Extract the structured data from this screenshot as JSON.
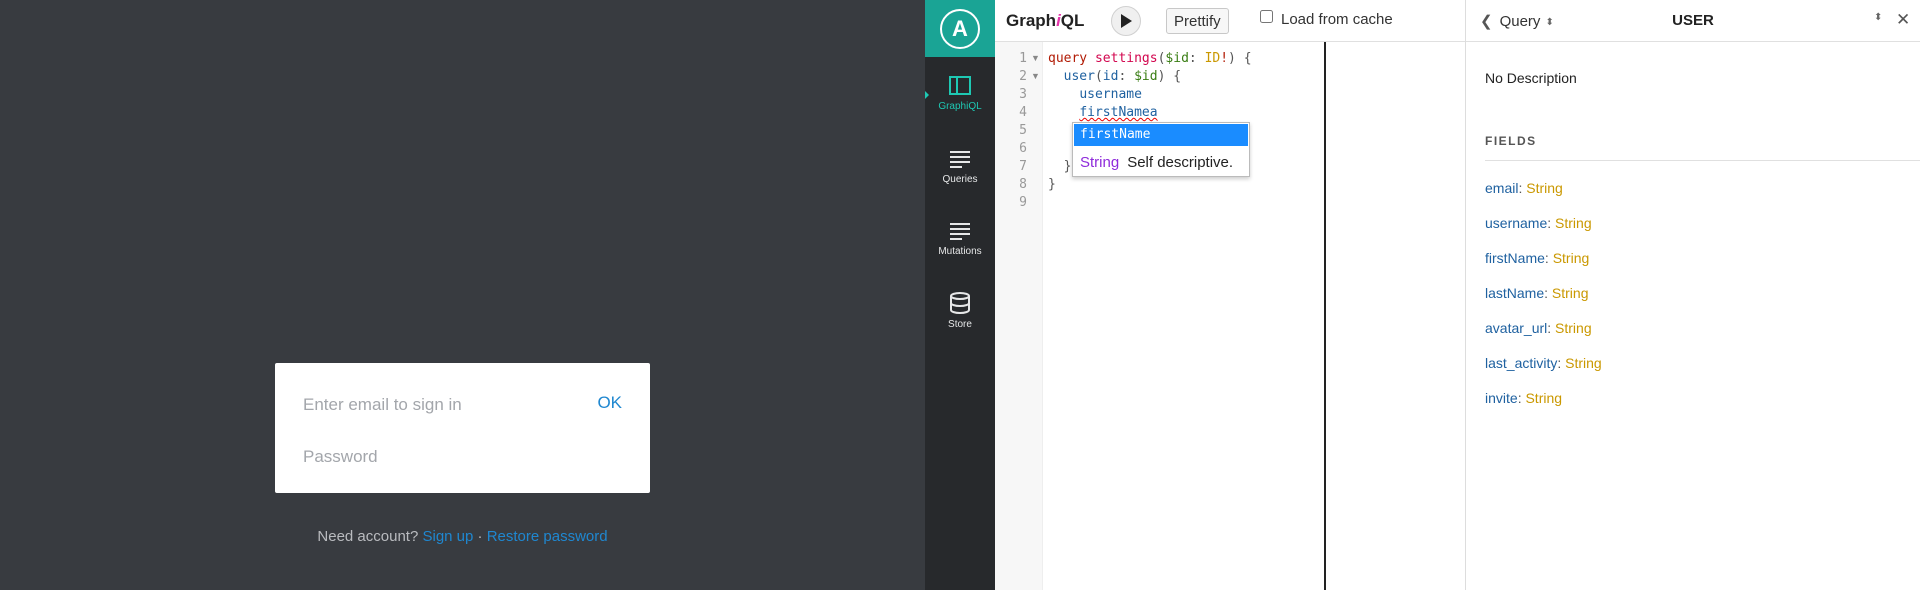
{
  "login": {
    "email_placeholder": "Enter email to sign in",
    "ok_label": "OK",
    "password_placeholder": "Password",
    "need_account": "Need account?",
    "sign_up": "Sign up",
    "separator": "·",
    "restore": "Restore password"
  },
  "rail": {
    "logo": "A",
    "items": [
      {
        "label": "GraphiQL",
        "icon": "graphiql-icon",
        "active": true
      },
      {
        "label": "Queries",
        "icon": "list-icon",
        "active": false
      },
      {
        "label": "Mutations",
        "icon": "list-icon",
        "active": false
      },
      {
        "label": "Store",
        "icon": "database-icon",
        "active": false
      }
    ]
  },
  "toolbar": {
    "title_a": "Graph",
    "title_b": "i",
    "title_c": "QL",
    "prettify": "Prettify",
    "cache_label": "Load from cache"
  },
  "editor": {
    "line_numbers": [
      "1",
      "2",
      "3",
      "4",
      "5",
      "6",
      "7",
      "8",
      "9"
    ],
    "line1": {
      "kw": "query",
      "name": "settings",
      "open": "(",
      "var": "$id",
      "colon": ":",
      "type": "ID",
      "bang": "!",
      "close": ") {"
    },
    "line2": {
      "field": "user",
      "open": "(",
      "arg": "id",
      "colon": ":",
      "var": "$id",
      "close": ") {"
    },
    "line3": "username",
    "line4": "firstNamea",
    "line7": "}",
    "line8": "}"
  },
  "autocomplete": {
    "item": "firstName",
    "type": "String",
    "description": "Self descriptive."
  },
  "docs": {
    "back_label": "Query",
    "title": "USER",
    "description": "No Description",
    "fields_heading": "FIELDS",
    "fields": [
      {
        "name": "email",
        "type": "String"
      },
      {
        "name": "username",
        "type": "String"
      },
      {
        "name": "firstName",
        "type": "String"
      },
      {
        "name": "lastName",
        "type": "String"
      },
      {
        "name": "avatar_url",
        "type": "String"
      },
      {
        "name": "last_activity",
        "type": "String"
      },
      {
        "name": "invite",
        "type": "String"
      }
    ]
  },
  "colors": {
    "login_bg": "#383b40",
    "rail_bg": "#27292c",
    "accent_teal": "#1aa495",
    "link_blue": "#1f87d0",
    "field_name": "#1f61a0",
    "field_type": "#ca9800"
  }
}
